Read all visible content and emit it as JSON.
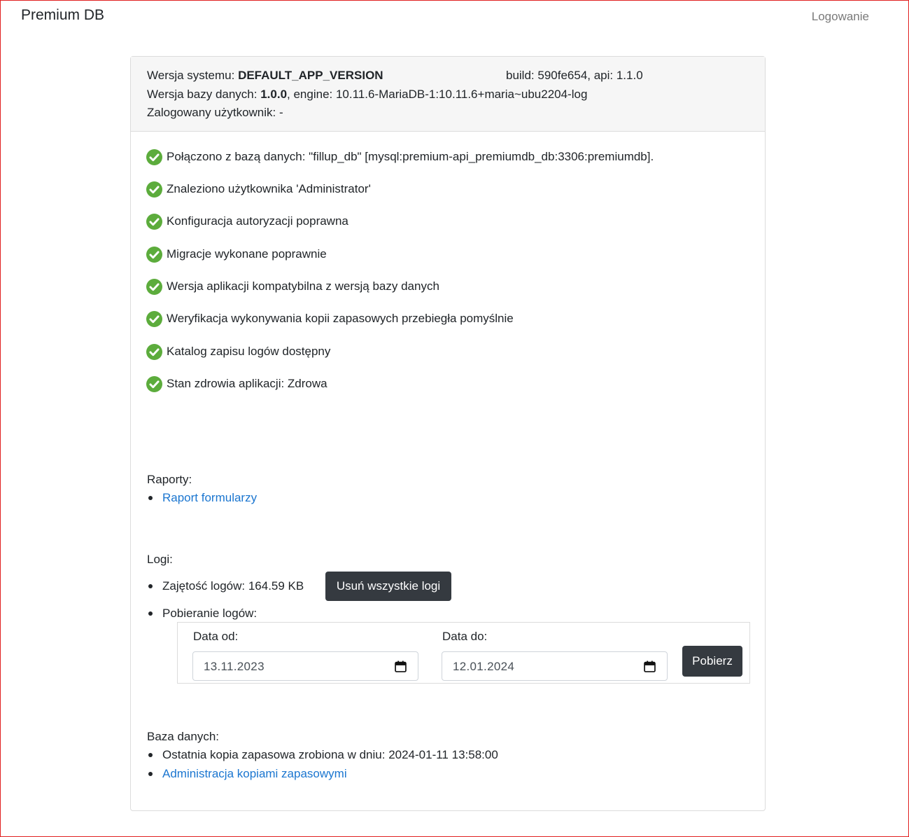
{
  "navbar": {
    "brand": "Premium DB",
    "login": "Logowanie"
  },
  "header": {
    "system_version_label": "Wersja systemu: ",
    "system_version_value": "DEFAULT_APP_VERSION",
    "build_info": "build: 590fe654, api: 1.1.0",
    "db_version_label": "Wersja bazy danych: ",
    "db_version_value": "1.0.0",
    "db_engine": ", engine: 10.11.6-MariaDB-1:10.11.6+maria~ubu2204-log",
    "user_line": "Zalogowany użytkownik: -"
  },
  "checks": [
    "Połączono z bazą danych: \"fillup_db\" [mysql:premium-api_premiumdb_db:3306:premiumdb].",
    "Znaleziono użytkownika 'Administrator'",
    "Konfiguracja autoryzacji poprawna",
    "Migracje wykonane poprawnie",
    "Wersja aplikacji kompatybilna z wersją bazy danych",
    "Weryfikacja wykonywania kopii zapasowych przebiegła pomyślnie",
    "Katalog zapisu logów dostępny",
    "Stan zdrowia aplikacji: Zdrowa"
  ],
  "reports": {
    "label": "Raporty:",
    "form_report_link": "Raport formularzy"
  },
  "logs": {
    "label": "Logi:",
    "usage": "Zajętość logów: 164.59 KB",
    "delete_button": "Usuń wszystkie logi",
    "download_label": "Pobieranie logów:",
    "date_from_label": "Data od:",
    "date_from_value": "13.11.2023",
    "date_to_label": "Data do:",
    "date_to_value": "12.01.2024",
    "download_button": "Pobierz"
  },
  "database": {
    "label": "Baza danych:",
    "last_backup": "Ostatnia kopia zapasowa zrobiona w dniu: 2024-01-11 13:58:00",
    "backup_admin_link": "Administracja kopiami zapasowymi"
  },
  "colors": {
    "check_green": "#5cac3c",
    "link_blue": "#1b76d0",
    "button_dark": "#353a40",
    "frame_red": "#e02020"
  }
}
